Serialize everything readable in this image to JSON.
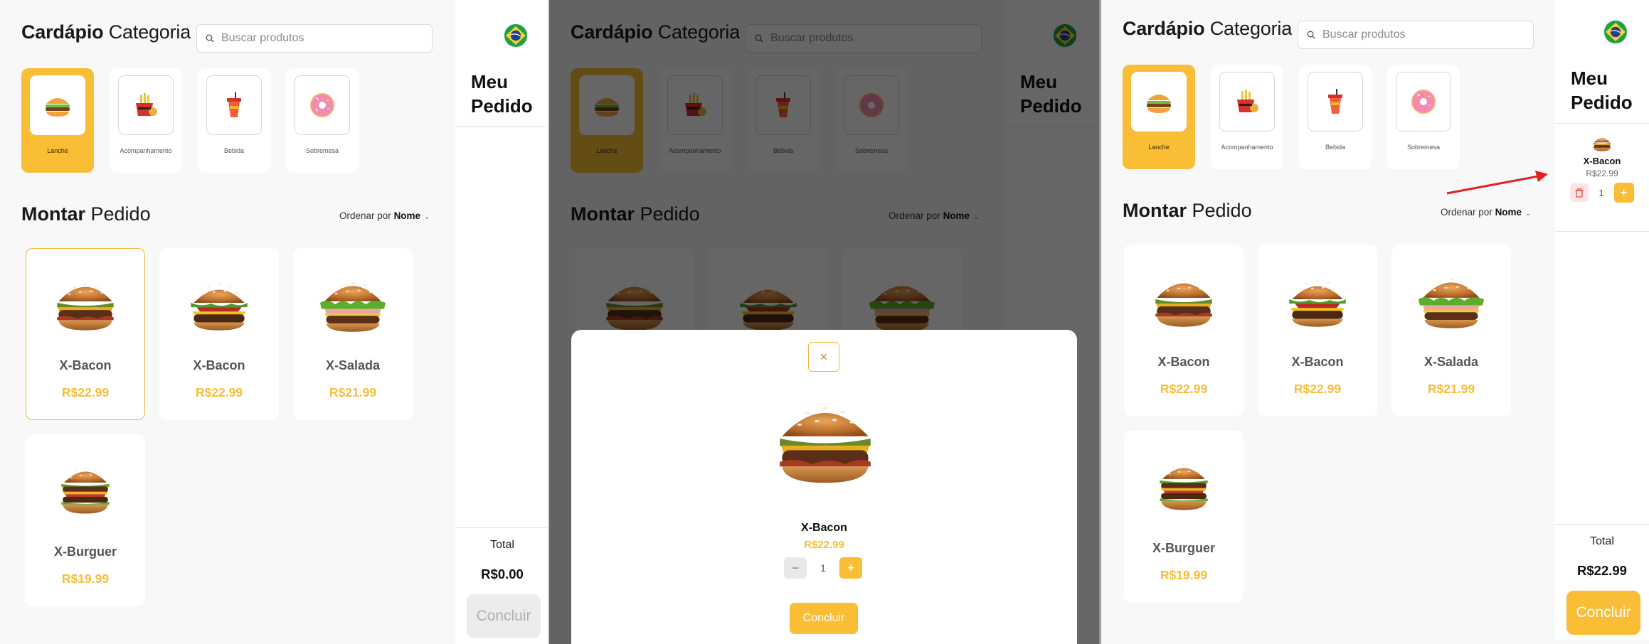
{
  "colors": {
    "accent": "#f9bd36",
    "danger": "#e04646",
    "arrow": "#e81e1e"
  },
  "header": {
    "title_bold": "Cardápio",
    "title_rest": "Categoria",
    "search_placeholder": "Buscar produtos"
  },
  "categories": [
    {
      "label": "Lanche",
      "icon": "burger-icon",
      "active": true
    },
    {
      "label": "Acompanhamento",
      "icon": "fries-bucket-icon",
      "active": false
    },
    {
      "label": "Bebida",
      "icon": "drink-cup-icon",
      "active": false
    },
    {
      "label": "Sobremesa",
      "icon": "donut-icon",
      "active": false
    }
  ],
  "section": {
    "title_bold": "Montar",
    "title_rest": "Pedido",
    "sort_label": "Ordenar por",
    "sort_value": "Nome"
  },
  "products": [
    {
      "name": "X-Bacon",
      "price": "R$22.99",
      "icon": "bacon-burger-image"
    },
    {
      "name": "X-Bacon",
      "price": "R$22.99",
      "icon": "cheese-burger-image"
    },
    {
      "name": "X-Salada",
      "price": "R$21.99",
      "icon": "salad-burger-image"
    },
    {
      "name": "X-Burguer",
      "price": "R$19.99",
      "icon": "double-burger-image"
    }
  ],
  "order": {
    "title_line1": "Meu",
    "title_line2": "Pedido",
    "total_label": "Total",
    "concluir_label": "Concluir",
    "flag_icon": "brazil-flag-icon"
  },
  "screens": {
    "empty": {
      "total": "R$0.00"
    },
    "filled": {
      "total": "R$22.99",
      "item": {
        "name": "X-Bacon",
        "price": "R$22.99",
        "qty": "1"
      }
    }
  },
  "modal": {
    "close_label": "×",
    "name": "X-Bacon",
    "price": "R$22.99",
    "qty": "1",
    "minus_label": "−",
    "plus_label": "+",
    "confirm_label": "Concluir"
  }
}
